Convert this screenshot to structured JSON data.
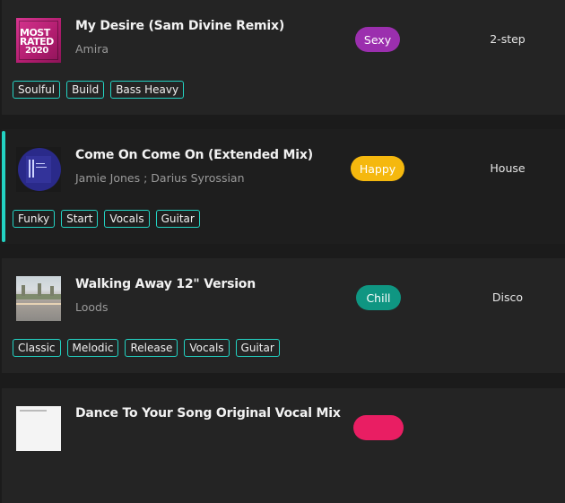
{
  "tracks": [
    {
      "title": "My Desire (Sam Divine Remix)",
      "artist": "Amira",
      "mood": "Sexy",
      "mood_color": "#9b2fae",
      "genre": "2-step",
      "tags": [
        "Soulful",
        "Build",
        "Bass Heavy"
      ],
      "art_text": [
        "MOST",
        "RATED",
        "2020"
      ]
    },
    {
      "title": "Come On Come On (Extended Mix)",
      "artist": "Jamie Jones ; Darius Syrossian",
      "mood": "Happy",
      "mood_color": "#f5b80e",
      "genre": "House",
      "tags": [
        "Funky",
        "Start",
        "Vocals",
        "Guitar"
      ]
    },
    {
      "title": "Walking Away 12\" Version",
      "artist": "Loods",
      "mood": "Chill",
      "mood_color": "#0f9682",
      "genre": "Disco",
      "tags": [
        "Classic",
        "Melodic",
        "Release",
        "Vocals",
        "Guitar"
      ]
    },
    {
      "title": "Dance To Your Song Original Vocal Mix",
      "mood_color": "#e91e63"
    }
  ]
}
